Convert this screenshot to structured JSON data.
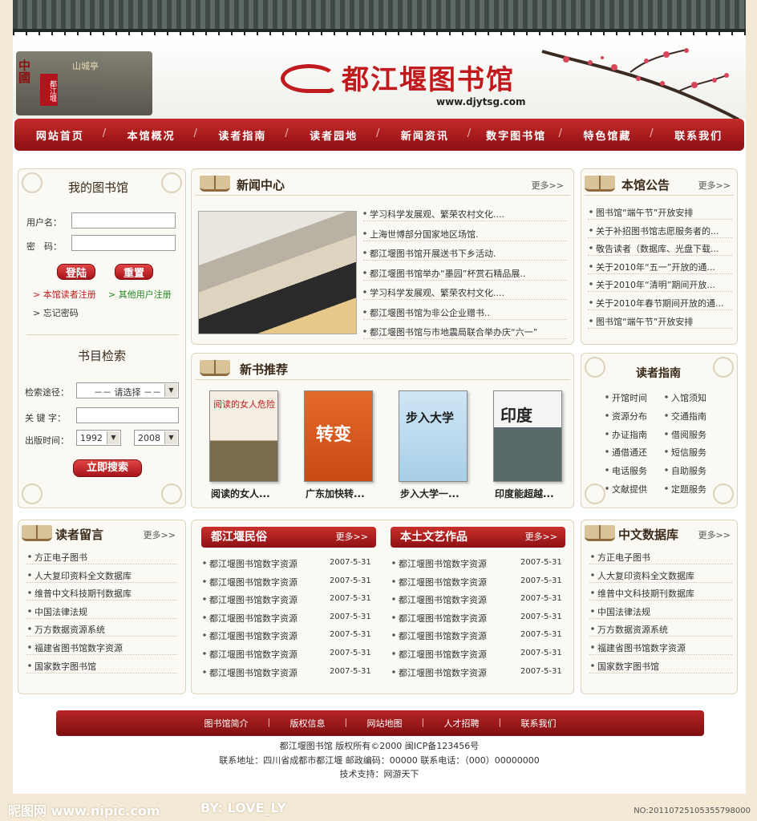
{
  "header": {
    "site_name": "都江堰图书馆",
    "site_url": "www.djytsg.com",
    "china_text": "中國",
    "seal_text": "都江堰",
    "building_sign": "山城亭"
  },
  "nav": [
    "网站首页",
    "本馆概况",
    "读者指南",
    "读者园地",
    "新闻资讯",
    "数字图书馆",
    "特色馆藏",
    "联系我们"
  ],
  "my_library": {
    "title": "我的图书馆",
    "username_label": "用户名：",
    "password_label": "密　码：",
    "login_btn": "登陆",
    "reset_btn": "重置",
    "reader_register": "本馆读者注册",
    "other_register": "其他用户注册",
    "forgot": "忘记密码"
  },
  "catalog": {
    "title": "书目检索",
    "path_label": "检索途径：",
    "path_value": "－－ 请选择 －－",
    "keyword_label": "关 键 字：",
    "time_label": "出版时间：",
    "year_from": "1992",
    "year_to": "2008",
    "search_btn": "立即搜索"
  },
  "news": {
    "title": "新闻中心",
    "more": "更多>>",
    "items": [
      "学习科学发展观、繁荣农村文化....",
      "上海世博部分国家地区场馆.",
      "都江堰图书馆开展送书下乡活动.",
      "都江堰图书馆举办“墨园”杯赏石精品展..",
      "学习科学发展观、繁荣农村文化....",
      "都江堰图书馆为非公企业赠书..",
      "都江堰图书馆与市地震局联合举办庆“六一”"
    ]
  },
  "notice": {
    "title": "本馆公告",
    "more": "更多>>",
    "items": [
      "图书馆“端午节”开放安排",
      "关于补招图书馆志愿服务者的...",
      "敬告读者（数据库、光盘下载...",
      "关于2010年“五一”开放的通...",
      "关于2010年“清明”期间开放...",
      "关于2010年春节期间开放的通...",
      "图书馆“端午节”开放安排"
    ]
  },
  "new_books": {
    "title": "新书推荐",
    "books": [
      {
        "title": "阅读的女人...",
        "cover_text": "阅读的女人危险"
      },
      {
        "title": "广东加快转...",
        "cover_text": "转变"
      },
      {
        "title": "步入大学一...",
        "cover_text": "步入大学"
      },
      {
        "title": "印度能超越...",
        "cover_text": "印度"
      }
    ]
  },
  "guide": {
    "title": "读者指南",
    "items": [
      "开馆时间",
      "入馆须知",
      "资源分布",
      "交通指南",
      "办证指南",
      "借阅服务",
      "通借通还",
      "短信服务",
      "电话服务",
      "自助服务",
      "文献提供",
      "定题服务"
    ]
  },
  "messages": {
    "title": "读者留言",
    "more": "更多>>",
    "items": [
      "方正电子图书",
      "人大复印资料全文数据库",
      "维普中文科技期刊数据库",
      "中国法律法规",
      "万方数据资源系统",
      "福建省图书馆数字资源",
      "国家数字图书馆"
    ]
  },
  "folk": {
    "title": "都江堰民俗",
    "more": "更多>>",
    "items": [
      "都江堰图书馆数字资源",
      "都江堰图书馆数字资源",
      "都江堰图书馆数字资源",
      "都江堰图书馆数字资源",
      "都江堰图书馆数字资源",
      "都江堰图书馆数字资源",
      "都江堰图书馆数字资源"
    ],
    "dates": [
      "2007-5-31",
      "2007-5-31",
      "2007-5-31",
      "2007-5-31",
      "2007-5-31",
      "2007-5-31",
      "2007-5-31"
    ]
  },
  "literature": {
    "title": "本土文艺作品",
    "more": "更多>>",
    "items": [
      "都江堰图书馆数字资源",
      "都江堰图书馆数字资源",
      "都江堰图书馆数字资源",
      "都江堰图书馆数字资源",
      "都江堰图书馆数字资源",
      "都江堰图书馆数字资源",
      "都江堰图书馆数字资源"
    ],
    "dates": [
      "2007-5-31",
      "2007-5-31",
      "2007-5-31",
      "2007-5-31",
      "2007-5-31",
      "2007-5-31",
      "2007-5-31"
    ]
  },
  "database": {
    "title": "中文数据库",
    "more": "更多>>",
    "items": [
      "方正电子图书",
      "人大复印资料全文数据库",
      "维普中文科技期刊数据库",
      "中国法律法规",
      "万方数据资源系统",
      "福建省图书馆数字资源",
      "国家数字图书馆"
    ]
  },
  "footer": {
    "links": [
      "图书馆简介",
      "版权信息",
      "网站地图",
      "人才招聘",
      "联系我们"
    ],
    "line1": "都江堰图书馆  版权所有©2000    闽ICP备123456号",
    "line2": "联系地址：四川省成都市都江堰     邮政编码：00000    联系电话：（000）00000000",
    "line3": "技术支持：网游天下"
  },
  "watermark": {
    "site": "昵图网 www.nipic.com",
    "by": "BY: LOVE_LY",
    "id": "NO:20110725105355798000"
  },
  "colors": {
    "brand_red": "#c01a1f",
    "nav_dark": "#8e0f12",
    "page_bg": "#f3e9d4"
  }
}
